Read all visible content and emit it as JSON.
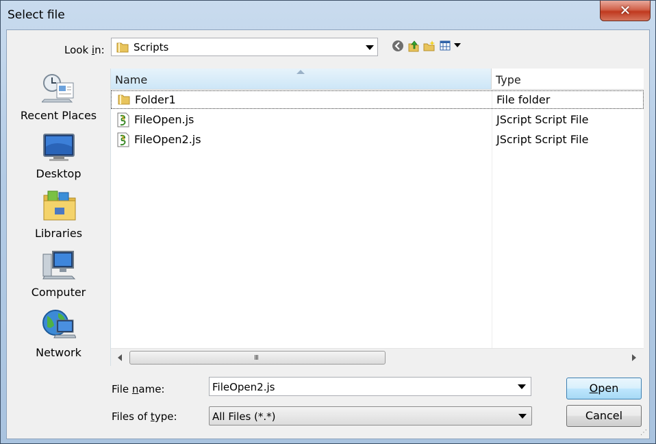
{
  "window": {
    "title": "Select file",
    "close_symbol": "✕"
  },
  "toolbar": {
    "look_in_label_pre": "Look ",
    "look_in_label_ul": "i",
    "look_in_label_post": "n:",
    "look_in_value": "Scripts"
  },
  "places": [
    {
      "label": "Recent Places",
      "icon": "recent-places-icon"
    },
    {
      "label": "Desktop",
      "icon": "desktop-icon"
    },
    {
      "label": "Libraries",
      "icon": "libraries-icon"
    },
    {
      "label": "Computer",
      "icon": "computer-icon"
    },
    {
      "label": "Network",
      "icon": "network-icon"
    }
  ],
  "list": {
    "columns": [
      "Name",
      "Type"
    ],
    "rows": [
      {
        "name": "Folder1",
        "type": "File folder",
        "icon": "folder-icon"
      },
      {
        "name": "FileOpen.js",
        "type": "JScript Script File",
        "icon": "script-file-icon"
      },
      {
        "name": "FileOpen2.js",
        "type": "JScript Script File",
        "icon": "script-file-icon"
      }
    ],
    "scroll_grip": "III"
  },
  "bottom": {
    "file_name_label_pre": "File ",
    "file_name_label_ul": "n",
    "file_name_label_post": "ame:",
    "file_name_value": "FileOpen2.js",
    "file_type_label_pre": "Files of ",
    "file_type_label_ul": "t",
    "file_type_label_post": "ype:",
    "file_type_value": "All Files (*.*)",
    "open_ul": "O",
    "open_rest": "pen",
    "cancel": "Cancel"
  }
}
